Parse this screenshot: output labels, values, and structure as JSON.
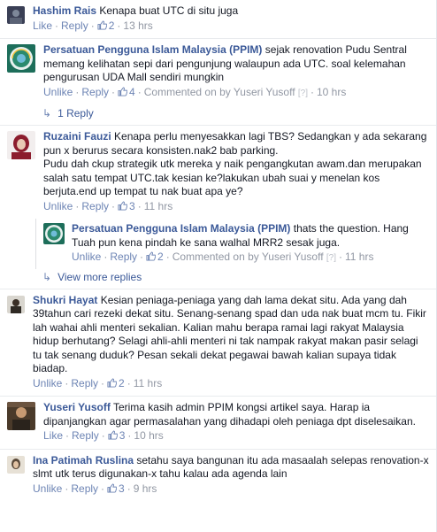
{
  "comments": [
    {
      "author": "Hashim Rais",
      "text": "Kenapa buat UTC di situ juga",
      "actions": {
        "like": "Like",
        "reply": "Reply",
        "likes": "2",
        "time": "13 hrs"
      }
    },
    {
      "author": "Persatuan Pengguna Islam Malaysia (PPIM)",
      "text": "sejak renovation Pudu Sentral memang kelihatan sepi dari pengunjung walaupun ada UTC. soal kelemahan pengurusan UDA Mall sendiri mungkin",
      "actions": {
        "like": "Unlike",
        "reply": "Reply",
        "likes": "4",
        "commented_by": "Commented on by",
        "commenter": "Yuseri Yusoff",
        "q": "[?]",
        "time": "10 hrs"
      },
      "reply_count": "1 Reply"
    },
    {
      "author": "Ruzaini Fauzi",
      "text": "Kenapa perlu menyesakkan lagi TBS? Sedangkan y ada sekarang pun x berurus secara konsisten.nak2 bab parking.",
      "text2": "Pudu dah ckup strategik utk mereka y naik pengangkutan awam.dan merupakan salah satu tempat UTC.tak kesian ke?lakukan ubah suai y menelan kos berjuta.end up tempat tu nak buat apa ye?",
      "actions": {
        "like": "Unlike",
        "reply": "Reply",
        "likes": "3",
        "time": "11 hrs"
      },
      "nested": {
        "author": "Persatuan Pengguna Islam Malaysia (PPIM)",
        "text": "thats the question. Hang Tuah pun kena pindah ke sana walhal MRR2 sesak juga.",
        "actions": {
          "like": "Unlike",
          "reply": "Reply",
          "likes": "2",
          "commented_by": "Commented on by",
          "commenter": "Yuseri Yusoff",
          "q": "[?]",
          "time": "11 hrs"
        }
      },
      "view_more": "View more replies"
    },
    {
      "author": "Shukri Hayat",
      "text": "Kesian peniaga-peniaga yang dah lama dekat situ. Ada yang dah 39tahun cari rezeki dekat situ. Senang-senang spad dan uda nak buat mcm tu. Fikir lah wahai ahli menteri sekalian. Kalian mahu berapa ramai lagi rakyat Malaysia hidup berhutang? Selagi ahli-ahli menteri ni tak nampak rakyat makan pasir selagi tu tak senang duduk? Pesan sekali dekat pegawai bawah kalian supaya tidak biadap.",
      "actions": {
        "like": "Unlike",
        "reply": "Reply",
        "likes": "2",
        "time": "11 hrs"
      }
    },
    {
      "author": "Yuseri Yusoff",
      "text": "Terima kasih admin PPIM kongsi artikel saya. Harap ia dipanjangkan agar permasalahan yang dihadapi oleh peniaga dpt diselesaikan.",
      "actions": {
        "like": "Like",
        "reply": "Reply",
        "likes": "3",
        "time": "10 hrs"
      }
    },
    {
      "author": "Ina Patimah Ruslina",
      "text": "setahu saya bangunan itu ada masaalah selepas renovation-x slmt utk terus digunakan-x tahu kalau ada agenda lain",
      "actions": {
        "like": "Unlike",
        "reply": "Reply",
        "likes": "3",
        "time": "9 hrs"
      }
    }
  ],
  "colors": {
    "link": "#3b5998",
    "meta": "#9197a3",
    "action": "#6d84b4",
    "border": "#e9ebee"
  }
}
